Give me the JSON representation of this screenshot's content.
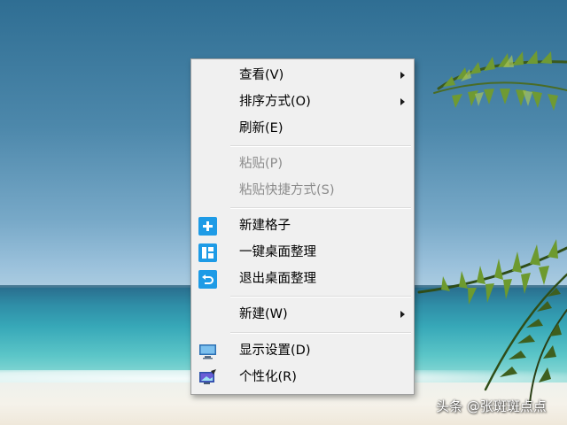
{
  "menu": {
    "items": [
      {
        "label": "查看(V)",
        "enabled": true,
        "submenu": true
      },
      {
        "label": "排序方式(O)",
        "enabled": true,
        "submenu": true
      },
      {
        "label": "刷新(E)",
        "enabled": true,
        "submenu": false
      },
      {
        "label": "粘贴(P)",
        "enabled": false,
        "submenu": false
      },
      {
        "label": "粘贴快捷方式(S)",
        "enabled": false,
        "submenu": false
      },
      {
        "label": "新建格子",
        "enabled": true,
        "icon": "plus-icon"
      },
      {
        "label": "一键桌面整理",
        "enabled": true,
        "icon": "grid-layout-icon"
      },
      {
        "label": "退出桌面整理",
        "enabled": true,
        "icon": "undo-icon"
      },
      {
        "label": "新建(W)",
        "enabled": true,
        "submenu": true
      },
      {
        "label": "显示设置(D)",
        "enabled": true,
        "icon": "monitor-icon"
      },
      {
        "label": "个性化(R)",
        "enabled": true,
        "icon": "personalize-icon"
      }
    ]
  },
  "watermark": "头条 @张斑斑点点",
  "colors": {
    "menu_bg": "#f0f0f0",
    "icon_blue": "#1e9be6",
    "disabled_text": "#8c8c8c"
  }
}
